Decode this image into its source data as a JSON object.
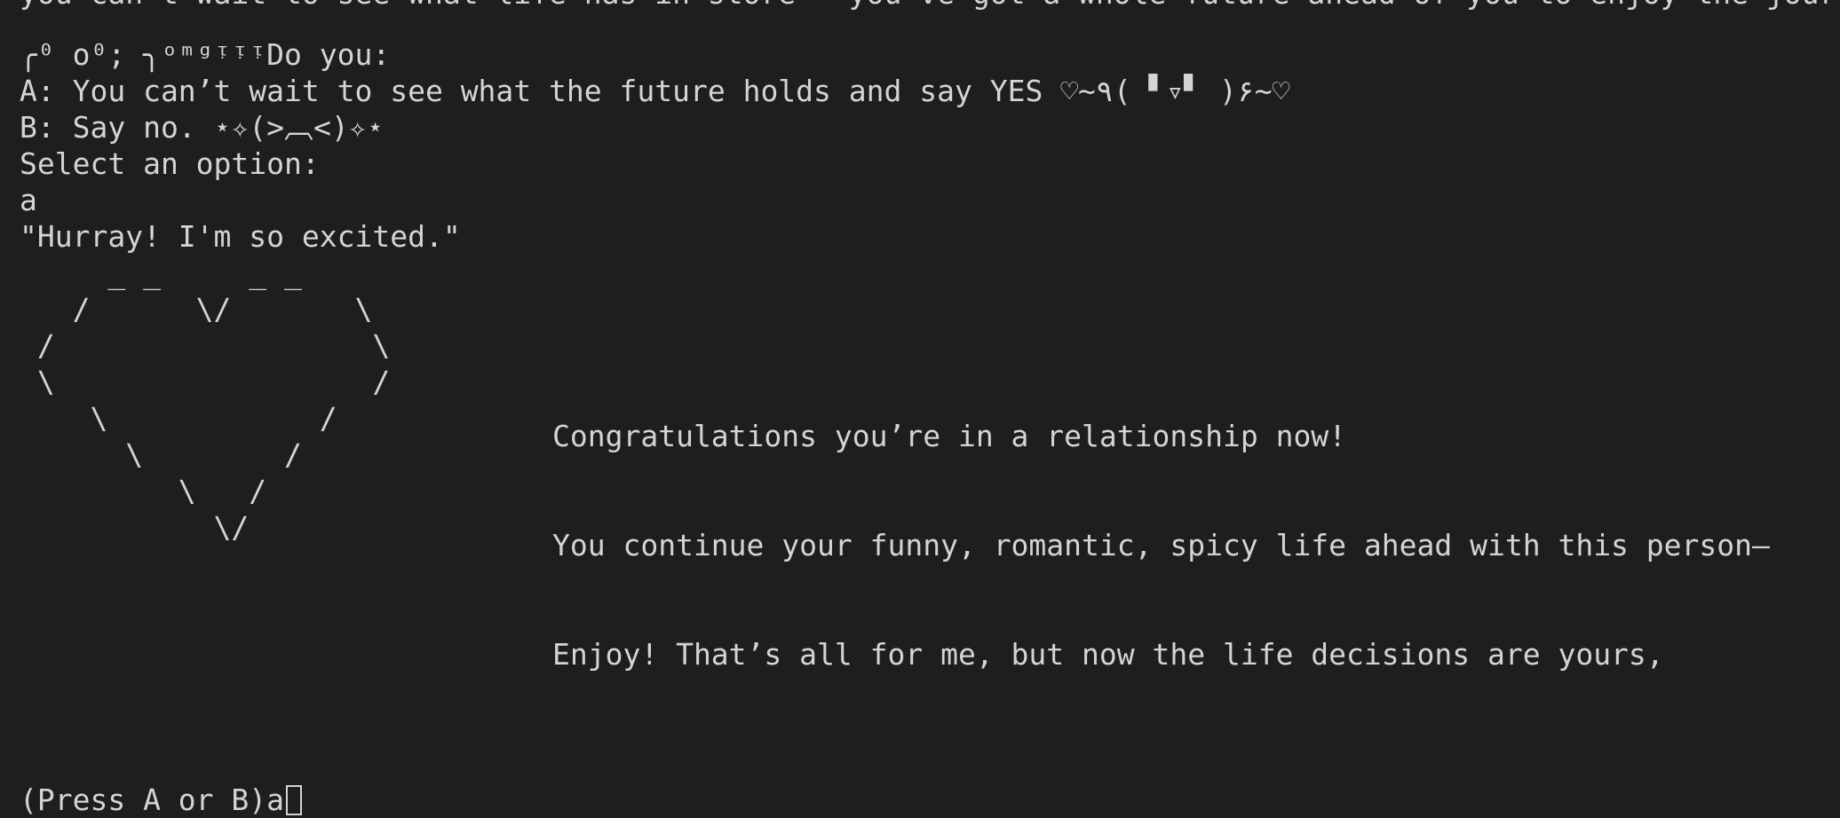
{
  "terminal": {
    "clipped_top": "you can't wait to see what life has in store — you've got a whole future ahead of you to enjoy the journey and plenty to go",
    "question": "╭⁰ o⁰; ╮ᵒᵐᵍᵎᵎᵎDo you:",
    "option_a": "A: You can’t wait to see what the future holds and say YES ♡~٩( ▘▿▘ )۶~♡",
    "option_b": "B: Say no. ⋆✧(>︹<)✧⋆",
    "select_prompt": "Select an option:",
    "user_input": "a",
    "reaction": "\"Hurray! I'm so excited.\"",
    "heart_art": "     _ _     _ _\n   /      \\/       \\\n /                  \\\n \\                  /\n    \\            /\n      \\        /\n         \\   /\n           \\/",
    "message_line_1": "Congratulations you’re in a relationship now!",
    "message_line_2": "You continue your funny, romantic, spicy life ahead with this person—",
    "message_line_3": "Enjoy! That’s all for me, but now the life decisions are yours,",
    "final_prompt": "(Press A or B)",
    "final_input": "a"
  },
  "colors": {
    "background": "#1e1e1e",
    "text": "#d4d4d4"
  }
}
